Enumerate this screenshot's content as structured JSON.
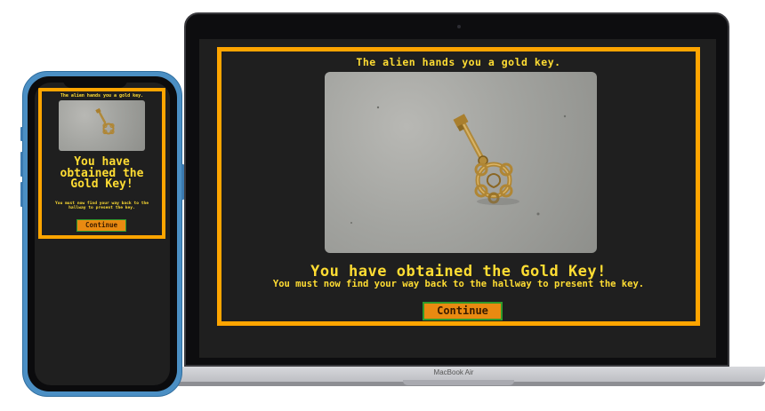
{
  "game": {
    "title": "The alien hands you a gold key.",
    "heading": "You have obtained the Gold Key!",
    "message": "You must now find your way back to the hallway to present the key.",
    "continue_label": "Continue"
  },
  "device": {
    "laptop_label": "MacBook Air"
  },
  "colors": {
    "frame": "#ffa500",
    "text": "#ffdd33",
    "button_bg": "#e98a11",
    "button_border": "#2f9a2b",
    "screen_bg": "#1f1f1f"
  },
  "icons": {
    "image_subject": "gold-key"
  }
}
